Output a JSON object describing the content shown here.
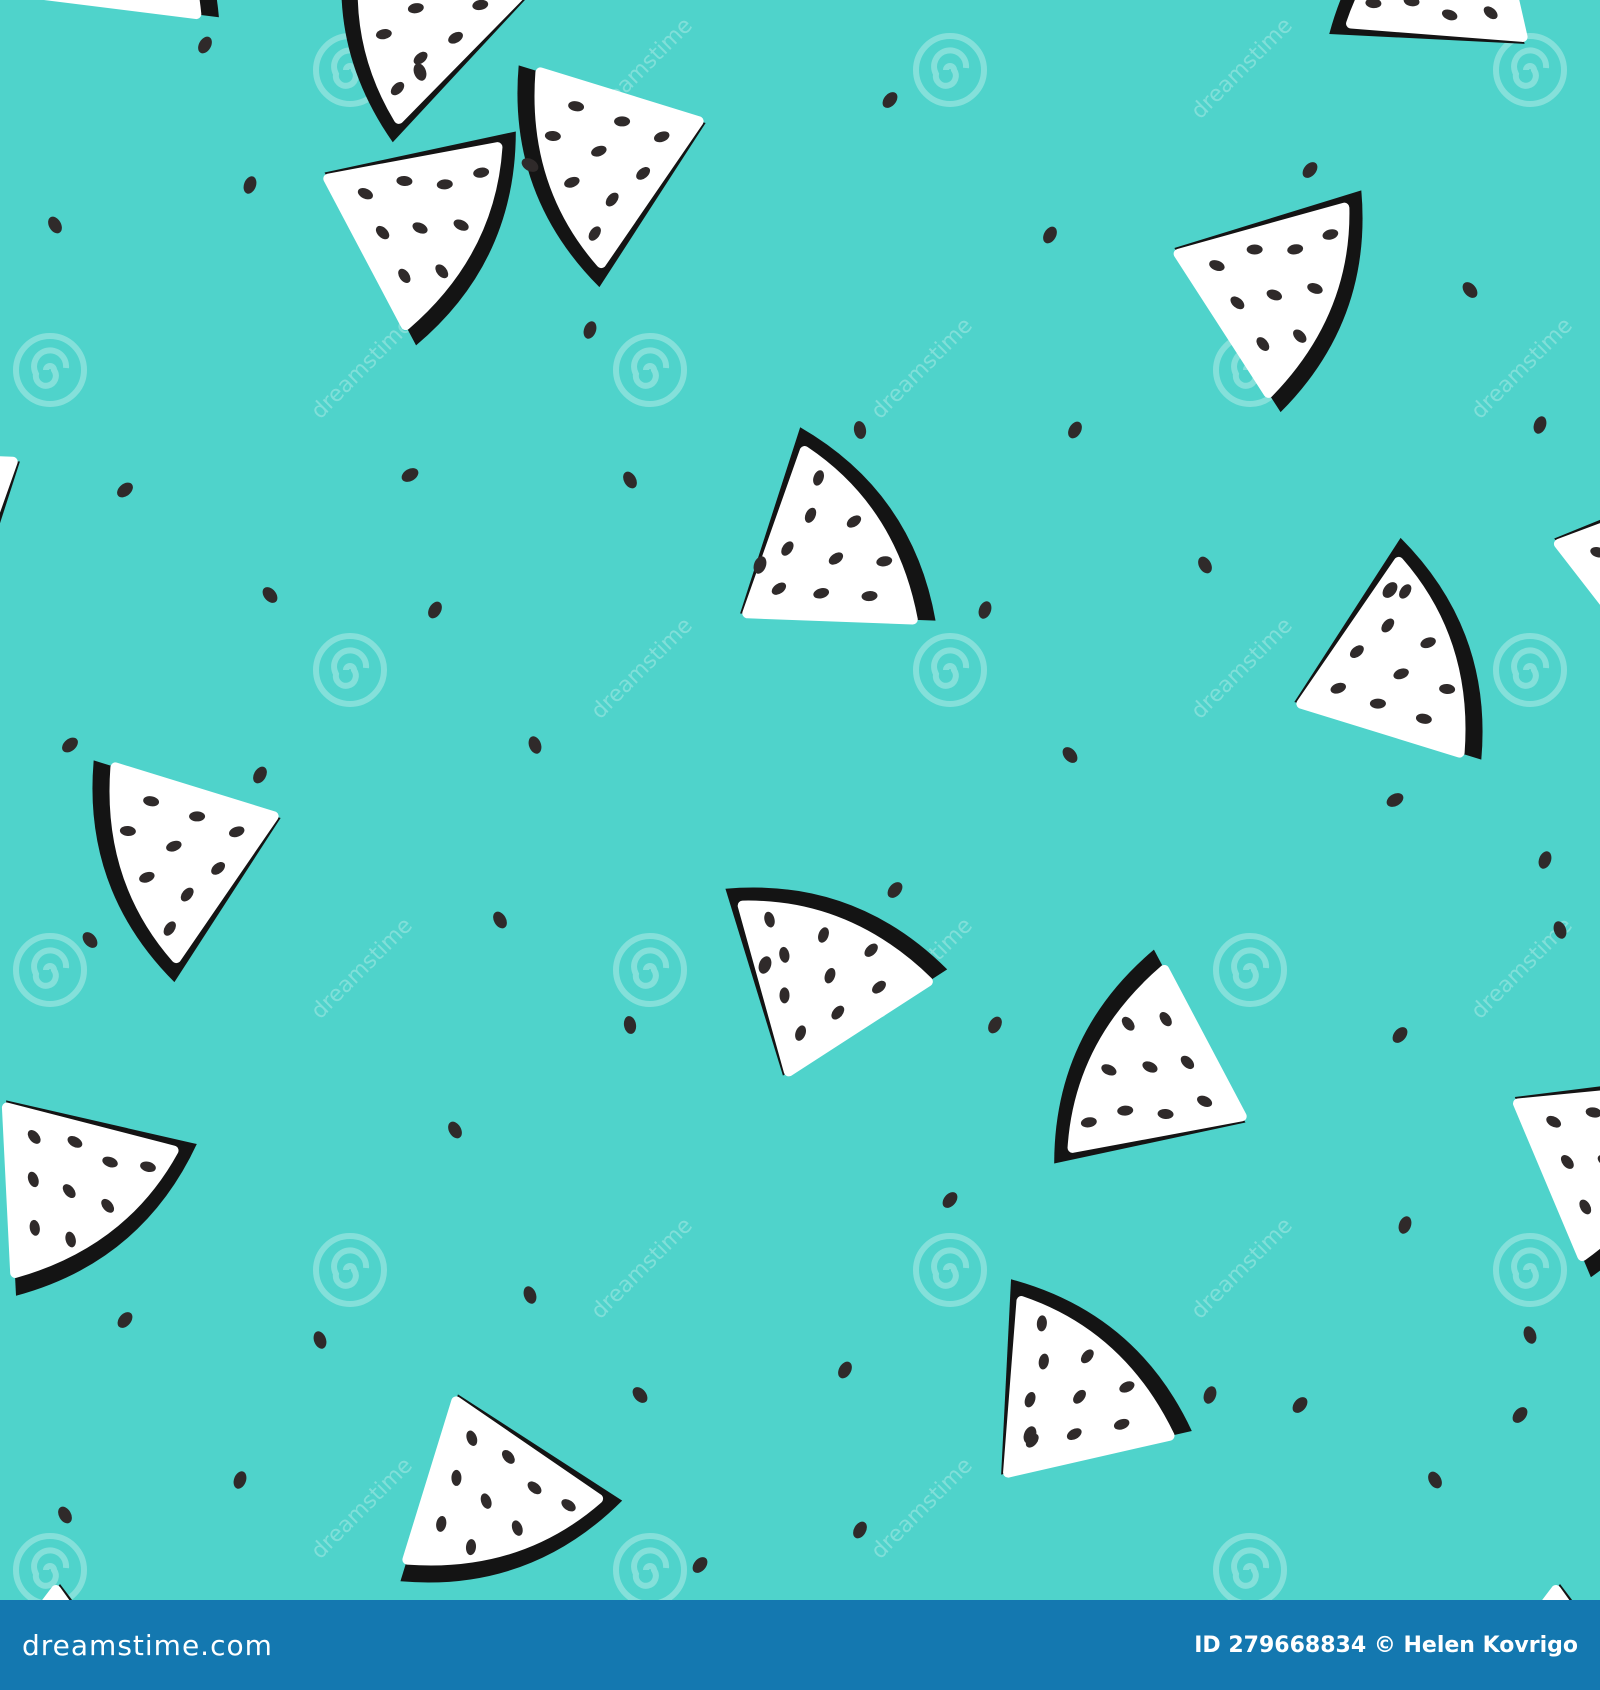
{
  "image": {
    "background_color": "#4fd3cb",
    "rind_color": "#141414",
    "flesh_color": "#ffffff",
    "seed_color": "#2f2a2a"
  },
  "watermark": {
    "repeat_text": "dreamstime",
    "icon": "spiral-logo-icon"
  },
  "footer": {
    "logo_text": "dreamstime.com",
    "id_label": "ID",
    "id_number": "279668834",
    "copyright_symbol": "©",
    "author": "Helen Kovrigo",
    "background_color": "#1478b0"
  }
}
